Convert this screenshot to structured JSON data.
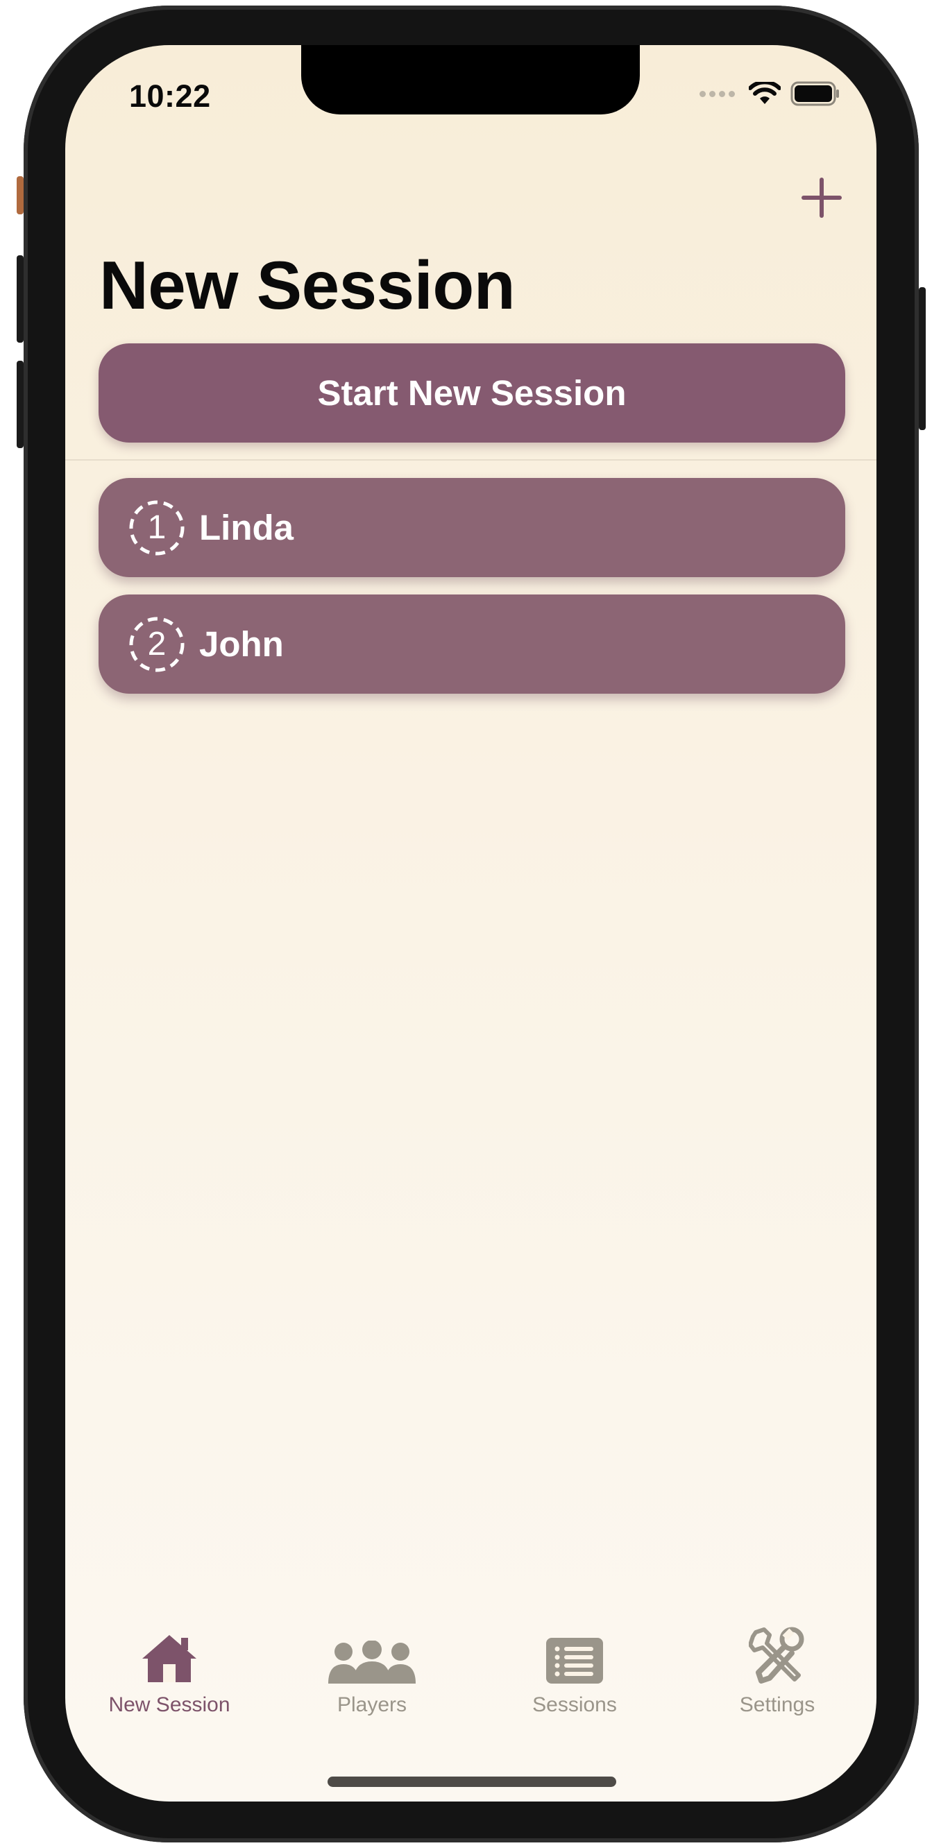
{
  "status_bar": {
    "time": "10:22",
    "icons": [
      "signal-dots-icon",
      "wifi-icon",
      "battery-icon"
    ]
  },
  "toolbar": {
    "add_icon": "plus-icon"
  },
  "page": {
    "title": "New Session"
  },
  "actions": {
    "start_label": "Start New Session"
  },
  "players": [
    {
      "number": "1",
      "name": "Linda"
    },
    {
      "number": "2",
      "name": "John"
    }
  ],
  "tab_bar": {
    "tabs": [
      {
        "label": "New Session",
        "icon": "house-icon",
        "active": true
      },
      {
        "label": "Players",
        "icon": "people-icon",
        "active": false
      },
      {
        "label": "Sessions",
        "icon": "list-icon",
        "active": false
      },
      {
        "label": "Settings",
        "icon": "tools-icon",
        "active": false
      }
    ]
  },
  "colors": {
    "accent": "#855a70",
    "row": "#8c6574",
    "background_top": "#f8edd8",
    "background_bottom": "#fcf8f1",
    "tab_inactive": "#9a958a"
  }
}
